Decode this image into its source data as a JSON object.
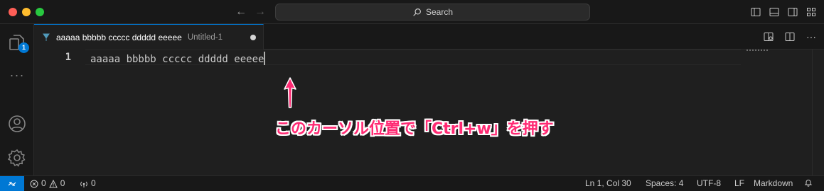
{
  "titlebar": {
    "search_label": "Search"
  },
  "activitybar": {
    "explorer_badge": "1",
    "more": "···"
  },
  "tab": {
    "title": "aaaaa bbbbb ccccc ddddd eeeee",
    "description": "Untitled-1"
  },
  "editor": {
    "line_number": "1",
    "line_text": "aaaaa bbbbb ccccc ddddd eeeee"
  },
  "annotation": {
    "text": "このカーソル位置で「Ctrl+w」を押す",
    "color": "#ff2a73"
  },
  "statusbar": {
    "errors": "0",
    "warnings": "0",
    "ports": "0",
    "position": "Ln 1, Col 30",
    "spaces": "Spaces: 4",
    "encoding": "UTF-8",
    "eol": "LF",
    "language": "Markdown"
  },
  "colors": {
    "accent": "#0078d4",
    "background": "#1f1f1f"
  }
}
